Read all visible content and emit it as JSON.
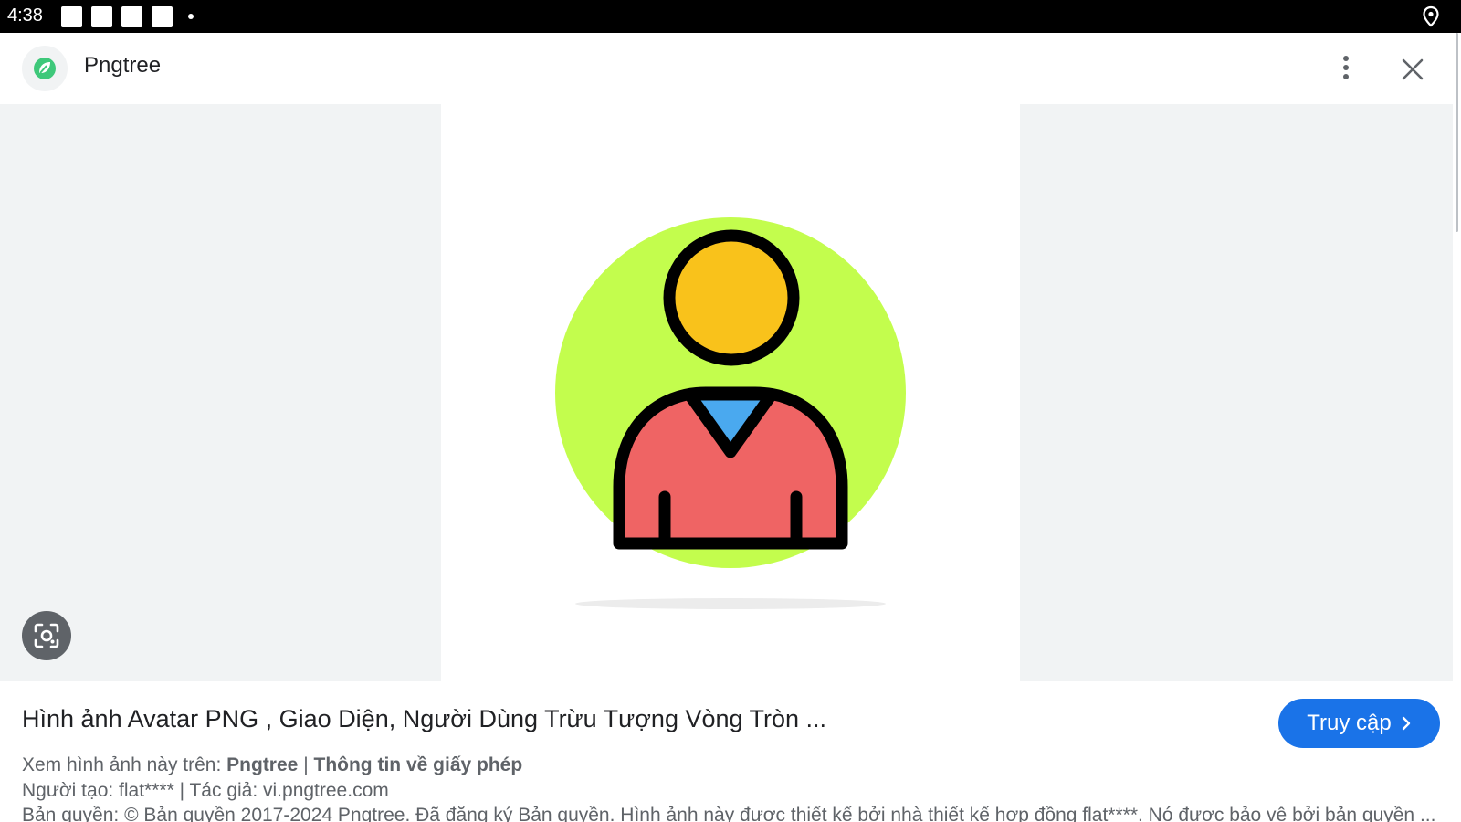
{
  "status_bar": {
    "time": "4:38"
  },
  "header": {
    "site_name": "Pngtree"
  },
  "image": {
    "alt": "Avatar icon: person silhouette on lime circle"
  },
  "result": {
    "title": "Hình ảnh Avatar PNG , Giao Diện, Người Dùng Trừu Tượng Vòng Tròn ...",
    "visit_label": "Truy cập",
    "view_on_prefix": "Xem hình ảnh này trên:",
    "view_on_site": "Pngtree",
    "separator": "|",
    "license_link": "Thông tin về giấy phép",
    "creator_line": "Người tạo: flat**** | Tác giả: vi.pngtree.com",
    "copyright_line": "Bản quyền: © Bản quyền 2017-2024 Pngtree. Đã đăng ký Bản quyền. Hình ảnh này được thiết kế bởi nhà thiết kế hợp đồng flat****. Nó được bảo vệ bởi bản quyền ..."
  },
  "colors": {
    "accent": "#1a73e8",
    "avatar_circle": "#c3fd4d",
    "avatar_head": "#f9c21b",
    "avatar_body": "#ef6464",
    "avatar_collar": "#4aa9ef"
  }
}
